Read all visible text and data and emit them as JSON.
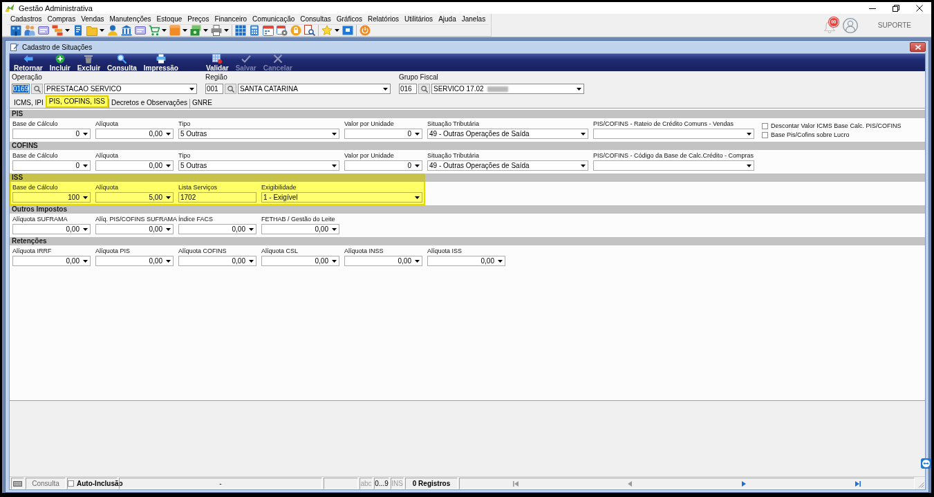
{
  "window": {
    "title": "Gestão Administrativa"
  },
  "menu": [
    "Cadastros",
    "Compras",
    "Vendas",
    "Manutenções",
    "Estoque",
    "Preços",
    "Financeiro",
    "Comunicação",
    "Consultas",
    "Gráficos",
    "Relatórios",
    "Utilitários",
    "Ajuda",
    "Janelas"
  ],
  "notifications": {
    "badge": "00"
  },
  "user": {
    "label": "SUPORTE"
  },
  "child_window": {
    "title": "Cadastro de Situações"
  },
  "action_groups": [
    {
      "buttons": [
        {
          "kind": "back",
          "label": "Retornar",
          "disabled": false
        },
        {
          "kind": "add",
          "label": "Incluir",
          "disabled": false
        },
        {
          "kind": "delete",
          "label": "Excluir",
          "disabled": false
        },
        {
          "kind": "search",
          "label": "Consulta",
          "disabled": false
        },
        {
          "kind": "print",
          "label": "Impressão",
          "disabled": false
        }
      ]
    },
    {
      "buttons": [
        {
          "kind": "validate",
          "label": "Validar",
          "disabled": false
        },
        {
          "kind": "save",
          "label": "Salvar",
          "disabled": true
        },
        {
          "kind": "cancel",
          "label": "Cancelar",
          "disabled": true
        }
      ]
    }
  ],
  "header_fields": [
    {
      "label": "Operação",
      "code": "0169",
      "code_selected": true,
      "value": "PRESTACAO SERVICO",
      "redacted": false
    },
    {
      "label": "Região",
      "code": "001",
      "code_selected": false,
      "value": "SANTA CATARINA",
      "redacted": false
    },
    {
      "label": "Grupo Fiscal",
      "code": "016",
      "code_selected": false,
      "value": "SERVICO 17.02",
      "redacted": true
    }
  ],
  "tabs": [
    {
      "label": "ICMS, IPI",
      "selected": false,
      "highlighted": false
    },
    {
      "label": "PIS, COFINS, ISS",
      "selected": true,
      "highlighted": true
    },
    {
      "label": "Decretos e Observações",
      "selected": false,
      "highlighted": false
    },
    {
      "label": "GNRE",
      "selected": false,
      "highlighted": false
    }
  ],
  "sections": [
    {
      "title": "PIS",
      "highlighted": false,
      "fields": [
        {
          "kind": "number",
          "label": "Base de Cálculo",
          "value": "0"
        },
        {
          "kind": "number",
          "label": "Alíquota",
          "value": "0,00"
        },
        {
          "kind": "select",
          "label": "Tipo",
          "value": "5 Outras"
        },
        {
          "kind": "number",
          "label": "Valor por Unidade",
          "value": "0"
        },
        {
          "kind": "select",
          "label": "Situação Tributária",
          "value": "49 - Outras Operações de Saída"
        },
        {
          "kind": "select",
          "label": "PIS/COFINS - Rateio de Crédito Comuns - Vendas"
        }
      ],
      "options": [
        {
          "label": "Descontar Valor ICMS Base Calc. PIS/COFINS",
          "checked": false
        },
        {
          "label": "Base Pis/Cofins sobre Lucro",
          "checked": false
        }
      ]
    },
    {
      "title": "COFINS",
      "highlighted": false,
      "fields": [
        {
          "kind": "number",
          "label": "Base de Cálculo",
          "value": "0"
        },
        {
          "kind": "number",
          "label": "Alíquota",
          "value": "0,00"
        },
        {
          "kind": "select",
          "label": "Tipo",
          "value": "5 Outras"
        },
        {
          "kind": "number",
          "label": "Valor por Unidade",
          "value": "0"
        },
        {
          "kind": "select",
          "label": "Situação Tributária",
          "value": "49 - Outras Operações de Saída"
        },
        {
          "kind": "select",
          "label": "PIS/COFINS - Código da Base de Calc.Crédito - Compras"
        }
      ]
    },
    {
      "title": "ISS",
      "highlighted": true,
      "fields": [
        {
          "kind": "number",
          "label": "Base de Cálculo",
          "value": "100"
        },
        {
          "kind": "number",
          "label": "Alíquota",
          "value": "5,00"
        },
        {
          "kind": "text",
          "label": "Lista Serviços",
          "value": "1702"
        },
        {
          "kind": "select",
          "label": "Exigibilidade",
          "value": "1 - Exigível"
        }
      ]
    },
    {
      "title": "Outros Impostos",
      "highlighted": false,
      "fields": [
        {
          "kind": "number",
          "label": "Alíquota SUFRAMA",
          "value": "0,00"
        },
        {
          "kind": "number",
          "label": "Alíq. PIS/COFINS SUFRAMA",
          "value": "0,00"
        },
        {
          "kind": "number",
          "label": "Índice FACS",
          "value": "0,00"
        },
        {
          "kind": "number",
          "label": "FETHAB / Gestão do Leite",
          "value": "0,00"
        }
      ]
    },
    {
      "title": "Retenções",
      "highlighted": false,
      "fields": [
        {
          "kind": "number",
          "label": "Alíquota IRRF",
          "value": "0,00"
        },
        {
          "kind": "number",
          "label": "Alíquota PIS",
          "value": "0,00"
        },
        {
          "kind": "number",
          "label": "Alíquota COFINS",
          "value": "0,00"
        },
        {
          "kind": "number",
          "label": "Alíquota CSL",
          "value": "0,00"
        },
        {
          "kind": "number",
          "label": "Alíquota INSS",
          "value": "0,00"
        },
        {
          "kind": "number",
          "label": "Alíquota ISS",
          "value": "0,00"
        }
      ]
    }
  ],
  "status_bar": {
    "mode": "Consulta",
    "auto_inclusion": {
      "label": "Auto-Inclusão",
      "checked": false
    },
    "message": "-",
    "indicators": [
      {
        "label": "abc",
        "on": false
      },
      {
        "label": "0...9",
        "on": true
      },
      {
        "label": "INS",
        "on": false
      }
    ],
    "records": "0 Registros",
    "navigation": [
      {
        "kind": "first",
        "disabled": true
      },
      {
        "kind": "previous",
        "disabled": true
      },
      {
        "kind": "next",
        "disabled": false
      },
      {
        "kind": "last",
        "disabled": false
      }
    ]
  }
}
